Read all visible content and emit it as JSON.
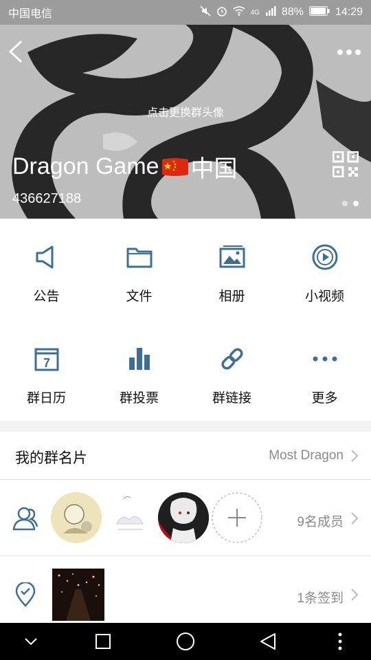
{
  "status": {
    "carrier": "中国电信",
    "network": "4G",
    "battery": "88%",
    "time": "14:29"
  },
  "hero": {
    "change_avatar_label": "点击更换群头像",
    "group_name_prefix": "Dragon Game",
    "group_name_suffix": "中国",
    "group_id": "436627188"
  },
  "features": [
    {
      "label": "公告",
      "icon": "megaphone-icon"
    },
    {
      "label": "文件",
      "icon": "folder-icon"
    },
    {
      "label": "相册",
      "icon": "album-icon"
    },
    {
      "label": "小视频",
      "icon": "video-icon"
    },
    {
      "label": "群日历",
      "icon": "calendar-icon"
    },
    {
      "label": "群投票",
      "icon": "bar-chart-icon"
    },
    {
      "label": "群链接",
      "icon": "link-icon"
    },
    {
      "label": "更多",
      "icon": "more-icon"
    }
  ],
  "calendar_day": "7",
  "my_card": {
    "label": "我的群名片",
    "value": "Most Dragon"
  },
  "members": {
    "count_label": "9名成员"
  },
  "checkin": {
    "count_label": "1条签到"
  },
  "colors": {
    "accent": "#3d6f93",
    "icon_color": "#3d6f93"
  }
}
